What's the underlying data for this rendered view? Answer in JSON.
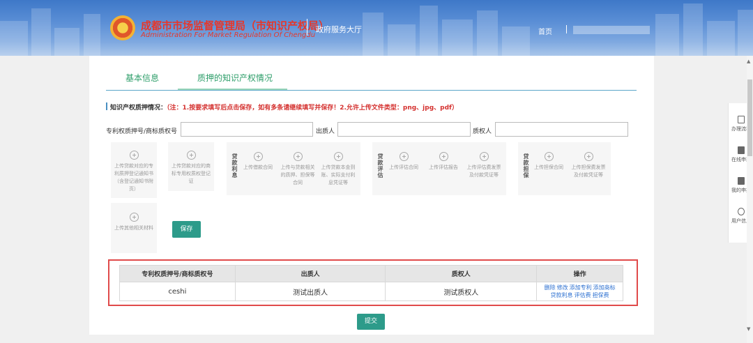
{
  "header": {
    "org_name_cn": "成都市市场监督管理局（市知识产权局）",
    "org_name_en": "Administration For Market Regulation Of Chengdu",
    "hall": "政府服务大厅",
    "home": "首页"
  },
  "tabs": [
    {
      "label": "基本信息"
    },
    {
      "label": "质押的知识产权情况"
    }
  ],
  "notice": {
    "label": "知识产权质押情况：",
    "text": "（注：1.按要求填写后点击保存，如有多条请继续填写并保存！2.允许上传文件类型：png、jpg、pdf）"
  },
  "form": {
    "patent_no_label": "专利权质押号/商标质权号",
    "pledgor_label": "出质人",
    "pledgee_label": "质权人"
  },
  "uploads": {
    "item1": "上传贷款对应的专利质押登记通知书（含登记通知书附页）",
    "item2": "上传贷款对应的商标专用权质权登记证",
    "group1_label": "贷款利息",
    "group1_items": [
      "上传借款合同",
      "上传与贷款相关的质押、担保等合同",
      "上传贷款本金到账、实际支付利息凭证等"
    ],
    "group2_label": "贷款评估",
    "group2_items": [
      "上传评估合同",
      "上传评估报告",
      "上传评估费发票及付款凭证等"
    ],
    "group3_label": "贷款担保",
    "group3_items": [
      "上传担保合同",
      "上传担保费发票及付款凭证等"
    ],
    "other": "上传其他相关材料"
  },
  "save_label": "保存",
  "table": {
    "headers": [
      "专利权质押号/商标质权号",
      "出质人",
      "质权人",
      "操作"
    ],
    "rows": [
      {
        "patent_no": "ceshi",
        "pledgor": "测试出质人",
        "pledgee": "测试质权人",
        "ops": [
          "删除",
          "修改",
          "添加专利",
          "添加商标",
          "贷款利息",
          "评估费",
          "担保费"
        ]
      }
    ]
  },
  "submit_label": "提交",
  "side": [
    "办理流程",
    "在线申报",
    "我的申报",
    "用户信息"
  ]
}
